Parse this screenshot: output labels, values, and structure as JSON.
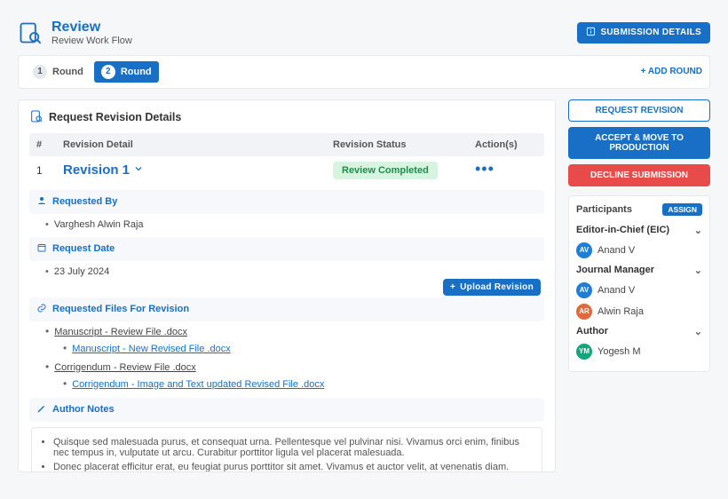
{
  "header": {
    "title": "Review",
    "subtitle": "Review Work Flow",
    "submission_btn": "SUBMISSION DETAILS"
  },
  "rounds": {
    "label": "Round",
    "items": [
      {
        "num": "1",
        "active": false
      },
      {
        "num": "2",
        "active": true
      }
    ],
    "add": "+ ADD ROUND"
  },
  "revision": {
    "title": "Request Revision Details",
    "columns": {
      "idx": "#",
      "detail": "Revision Detail",
      "status": "Revision Status",
      "actions": "Action(s)"
    },
    "row": {
      "idx": "1",
      "name": "Revision 1",
      "status": "Review Completed"
    },
    "requested_by_label": "Requested By",
    "requested_by_value": "Varghesh Alwin Raja",
    "request_date_label": "Request Date",
    "request_date_value": "23 July 2024",
    "files_label": "Requested Files For Revision",
    "upload_btn": "Upload Revision",
    "files": [
      {
        "name": "Manuscript - Review File .docx",
        "children": [
          "Manuscript - New Revised File .docx"
        ]
      },
      {
        "name": "Corrigendum - Review File .docx",
        "children": [
          "Corrigendum - Image and Text updated Revised File .docx"
        ]
      }
    ],
    "notes_label": "Author Notes",
    "notes": [
      "Quisque sed malesuada purus, et consequat urna. Pellentesque vel pulvinar nisi. Vivamus orci enim, finibus nec tempus in, vulputate ut arcu. Curabitur porttitor ligula vel placerat malesuada.",
      "Donec placerat efficitur erat, eu feugiat purus porttitor sit amet. Vivamus et auctor velit, at venenatis diam."
    ]
  },
  "actions": {
    "request": "REQUEST REVISION",
    "accept": "ACCEPT & MOVE TO PRODUCTION",
    "decline": "DECLINE SUBMISSION"
  },
  "participants": {
    "title": "Participants",
    "assign": "ASSIGN",
    "groups": [
      {
        "role": "Editor-in-Chief (EIC)",
        "people": [
          {
            "initials": "AV",
            "name": "Anand V",
            "color": "#1f7ed6"
          }
        ]
      },
      {
        "role": "Journal Manager",
        "people": [
          {
            "initials": "AV",
            "name": "Anand V",
            "color": "#1f7ed6"
          },
          {
            "initials": "AR",
            "name": "Alwin Raja",
            "color": "#e06a3b"
          }
        ]
      },
      {
        "role": "Author",
        "people": [
          {
            "initials": "YM",
            "name": "Yogesh M",
            "color": "#12a77a"
          }
        ]
      }
    ]
  }
}
